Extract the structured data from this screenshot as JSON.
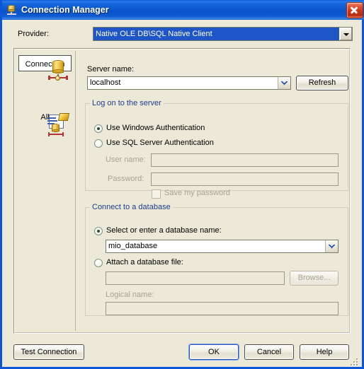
{
  "window": {
    "title": "Connection Manager",
    "title_icon": "connection-manager-icon",
    "close_icon": "close-icon",
    "accent_title_blue": "#0a53c8",
    "dialog_background": "#ece9d8",
    "group_legend_color": "#1f3c8c",
    "selection_blue": "#1e56c8"
  },
  "provider": {
    "label": "Provider:",
    "value": "Native OLE DB\\SQL Native Client",
    "dropdown_icon": "chevron-down-icon"
  },
  "sidebar": {
    "items": [
      {
        "label": "Connection",
        "icon": "database-connection-icon",
        "selected": true
      },
      {
        "label": "All",
        "icon": "properties-list-icon",
        "selected": false
      }
    ]
  },
  "server": {
    "label": "Server name:",
    "value": "localhost",
    "placeholder": "",
    "refresh_label": "Refresh",
    "dropdown_icon": "chevron-down-icon"
  },
  "logon": {
    "legend": "Log on to the server",
    "windows_auth": {
      "label": "Use Windows Authentication",
      "checked": true
    },
    "sql_auth": {
      "label": "Use SQL Server Authentication",
      "checked": false
    },
    "username": {
      "label": "User name:",
      "value": "",
      "disabled": true
    },
    "password": {
      "label": "Password:",
      "value": "",
      "disabled": true
    },
    "save_password": {
      "label": "Save my password",
      "checked": false,
      "disabled": true
    }
  },
  "database": {
    "legend": "Connect to a database",
    "select_name": {
      "label": "Select or enter a database name:",
      "checked": true
    },
    "db_value": "mio_database",
    "db_dropdown_icon": "chevron-down-icon",
    "attach_file": {
      "label": "Attach a database file:",
      "checked": false
    },
    "attach_value": "",
    "browse_label": "Browse...",
    "logical_name": {
      "label": "Logical name:",
      "value": "",
      "disabled": true
    }
  },
  "footer": {
    "test_connection": "Test Connection",
    "ok": "OK",
    "cancel": "Cancel",
    "help": "Help",
    "resize_grip": "resize-grip-icon"
  }
}
